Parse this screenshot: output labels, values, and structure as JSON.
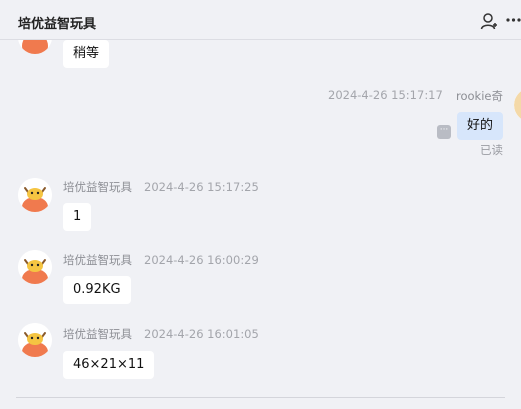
{
  "header": {
    "title": "培优益智玩具",
    "icons": [
      "add-contact-icon",
      "more-icon"
    ]
  },
  "messages": [
    {
      "side": "left",
      "text": "稍等"
    },
    {
      "side": "right",
      "sender": "rookie奇",
      "time": "2024-4-26 15:17:17",
      "text": "好的",
      "status": "已读"
    },
    {
      "side": "left",
      "sender": "培优益智玩具",
      "time": "2024-4-26 15:17:25",
      "text": "1"
    },
    {
      "side": "left",
      "sender": "培优益智玩具",
      "time": "2024-4-26 16:00:29",
      "text": "0.92KG"
    },
    {
      "side": "left",
      "sender": "培优益智玩具",
      "time": "2024-4-26 16:01:05",
      "text": "46×21×11"
    }
  ],
  "colors": {
    "background": "#f0f1f5",
    "bubble_left": "#ffffff",
    "bubble_right": "#d7e6fb",
    "avatar_accent": "#f07a4e"
  }
}
